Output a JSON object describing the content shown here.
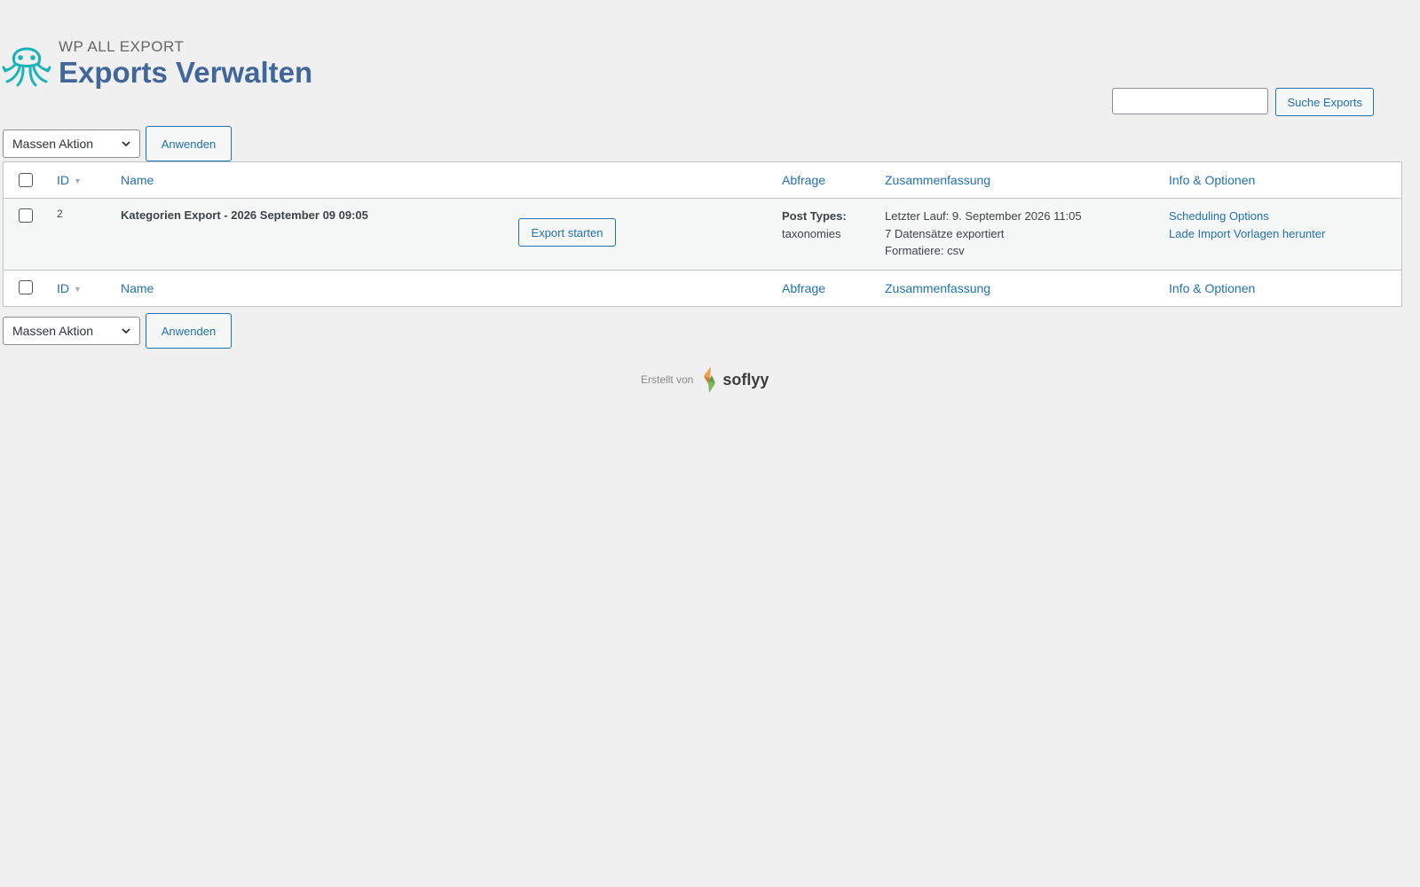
{
  "header": {
    "brand": "WP ALL EXPORT",
    "title": "Exports Verwalten"
  },
  "search": {
    "placeholder": "",
    "button_label": "Suche Exports"
  },
  "bulk_actions": {
    "selected": "Massen Aktion",
    "apply_label": "Anwenden"
  },
  "table": {
    "columns": {
      "id": "ID",
      "name": "Name",
      "query": "Abfrage",
      "summary": "Zusammenfassung",
      "info": "Info & Optionen"
    },
    "rows": [
      {
        "id": "2",
        "name": "Kategorien Export - 2026 September 09 09:05",
        "action_label": "Export starten",
        "query_label": "Post Types:",
        "query_value": "taxonomies",
        "summary_lines": [
          "Letzter Lauf: 9. September 2026 11:05",
          "7 Datensätze exportiert",
          "Formatiere: csv"
        ],
        "info_links": [
          "Scheduling Options",
          "Lade Import Vorlagen herunter"
        ]
      }
    ]
  },
  "footer": {
    "credit_label": "Erstellt von",
    "brand": "soflyy"
  },
  "colors": {
    "accent": "#2271b1",
    "title": "#40669a",
    "logo": "#1ab4b8",
    "background": "#f0f0f1"
  },
  "icons": {
    "logo": "octopus-icon",
    "sort": "sort-down-icon",
    "dropdown": "chevron-down-icon",
    "footer_logo": "soflyy-icon"
  }
}
